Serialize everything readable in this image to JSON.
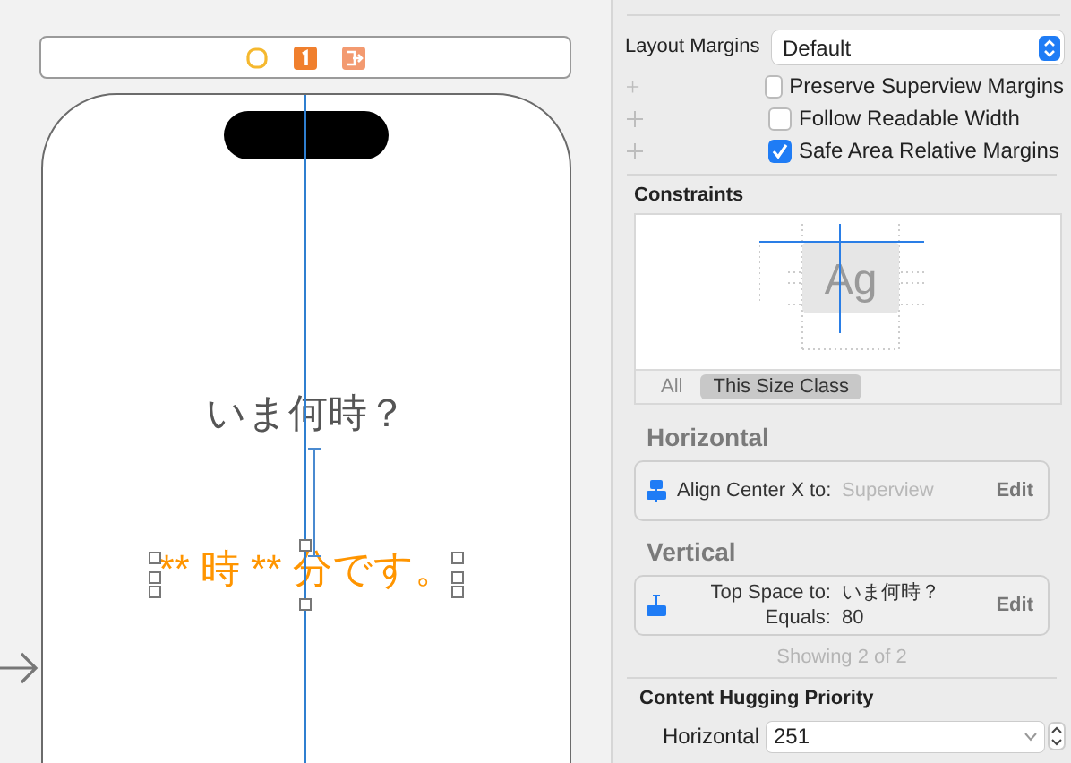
{
  "canvas": {
    "title_label": "いま何時？",
    "time_label": "** 時 ** 分です。"
  },
  "inspector": {
    "layout_margins": {
      "label": "Layout Margins",
      "value": "Default"
    },
    "options": [
      {
        "label": "Preserve Superview Margins",
        "checked": false
      },
      {
        "label": "Follow Readable Width",
        "checked": false
      },
      {
        "label": "Safe Area Relative Margins",
        "checked": true
      }
    ],
    "constraints": {
      "title": "Constraints",
      "preview_text": "Ag",
      "filters": [
        {
          "label": "All",
          "selected": false
        },
        {
          "label": "This Size Class",
          "selected": true
        }
      ]
    },
    "groups": [
      {
        "title": "Horizontal",
        "kind": "center",
        "lines": [
          {
            "key": "Align Center X to:",
            "value": "Superview",
            "muted": true
          }
        ],
        "action": "Edit"
      },
      {
        "title": "Vertical",
        "kind": "top",
        "lines": [
          {
            "key": "Top Space to:",
            "value": "いま何時？",
            "muted": false
          },
          {
            "key": "Equals:",
            "value": "80",
            "muted": false
          }
        ],
        "action": "Edit"
      }
    ],
    "showing": "Showing 2 of 2",
    "hugging": {
      "title": "Content Hugging Priority",
      "rows": [
        {
          "label": "Horizontal",
          "value": "251"
        }
      ]
    }
  }
}
